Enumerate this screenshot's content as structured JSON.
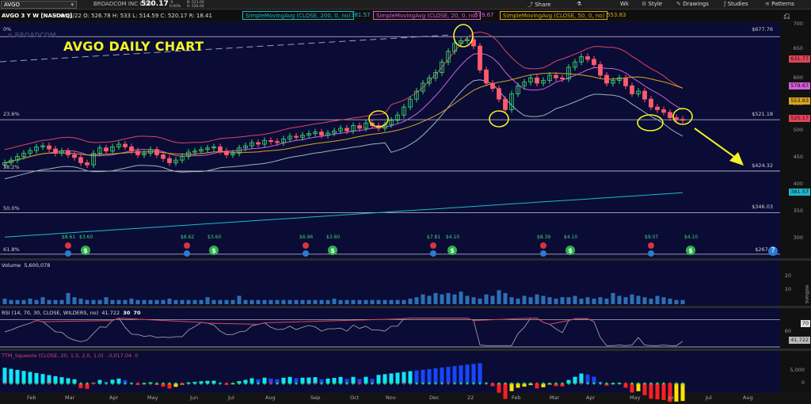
{
  "toolbar": {
    "symbol": "AVGO",
    "company": "BROADCOM INC COM",
    "last": "520.17",
    "change_line1": "-0",
    "change_line2": "0.00%",
    "bid_line": "B: 521.00",
    "ask_line": "A: 526.00",
    "share_label": "Share",
    "wk_label": "Wk",
    "style_label": "Style",
    "drawings_label": "Drawings",
    "studies_label": "Studies",
    "patterns_label": "Patterns"
  },
  "header": {
    "title_symbol": "AVGO 3 Y W [NASDAQ]",
    "quote": "D: 6/13/22   O: 526.78   H: 533   L: 514.59   C: 520.17   R: 18.41",
    "sma200_label": "SimpleMovingAvg (CLOSE, 200, 0, no)",
    "sma200_value": "381.57",
    "sma20_label": "SimpleMovingAvg (CLOSE, 20, 0, no)",
    "sma20_value": "579.67",
    "sma50_label": "SimpleMovingAvg (CLOSE, 50, 0, no)",
    "sma50_value": "553.83"
  },
  "annotation": {
    "title": "AVGO DAILY CHART",
    "watermark": "⊕ BROADCOM"
  },
  "fib": [
    {
      "label": "0%",
      "level": 677.76
    },
    {
      "label": "23.6%",
      "level": 521.18
    },
    {
      "label": "38.2%",
      "level": 424.32
    },
    {
      "label": "50.0%",
      "level": 346.03
    },
    {
      "label": "61.8%",
      "level": 267.7
    }
  ],
  "levels": [
    "$677.76",
    "$521.18",
    "$424.32",
    "$346.03",
    "$267.7"
  ],
  "price_axis": {
    "ticks": [
      "700",
      "650",
      "600",
      "550",
      "500",
      "450",
      "400",
      "350",
      "300"
    ],
    "badges": [
      {
        "text": "631.77",
        "color": "#e0445a"
      },
      {
        "text": "579.67",
        "color": "#d35fd8"
      },
      {
        "text": "553.83",
        "color": "#d8a520"
      },
      {
        "text": "520.17",
        "color": "#e0445a"
      },
      {
        "text": "381.57",
        "color": "#21b6c9"
      }
    ]
  },
  "volume": {
    "title": "Volume",
    "value": "5,600,078",
    "ticks": [
      "20",
      "10"
    ],
    "unit": "millions"
  },
  "rsi": {
    "title": "RSI (14, 70, 30, CLOSE, WILDERS, no)",
    "value": "41.722",
    "ob": "30",
    "os": "70",
    "ticks": [
      "70",
      "60"
    ],
    "badge": "41.722"
  },
  "squeeze": {
    "title": "TTM_Squeeze (CLOSE, 20, 1.5, 2.0, 1.0)",
    "value": "-3,017.04",
    "extra": "0",
    "ticks": [
      "5,000",
      "0"
    ]
  },
  "x_labels": [
    "Feb",
    "Mar",
    "Apr",
    "May",
    "Jun",
    "Jul",
    "Aug",
    "Sep",
    "Oct",
    "Nov",
    "Dec",
    "22",
    "Feb",
    "Mar",
    "Apr",
    "May",
    "Jun",
    "Jul",
    "Aug"
  ],
  "earnings_markers": [
    {
      "label": "$8.61"
    },
    {
      "label": "$3.60"
    },
    {
      "label": "$8.62"
    },
    {
      "label": "$3.60"
    },
    {
      "label": "$6.96"
    },
    {
      "label": "$3.60"
    },
    {
      "label": "$7.81"
    },
    {
      "label": "$4.10"
    },
    {
      "label": "$8.39"
    },
    {
      "label": "$4.10"
    },
    {
      "label": "$9.07"
    },
    {
      "label": "$4.10"
    }
  ],
  "chart_data": {
    "type": "candlestick",
    "title": "AVGO DAILY CHART",
    "ylim": [
      260,
      705
    ],
    "series": [
      {
        "name": "SMA 200",
        "color": "#21b6c9"
      },
      {
        "name": "SMA 20",
        "color": "#d35fd8"
      },
      {
        "name": "SMA 50",
        "color": "#d8a520"
      }
    ],
    "closes": [
      440,
      445,
      452,
      458,
      463,
      470,
      472,
      466,
      458,
      462,
      455,
      450,
      440,
      436,
      458,
      468,
      462,
      470,
      475,
      470,
      462,
      455,
      458,
      465,
      455,
      448,
      440,
      445,
      452,
      460,
      462,
      465,
      468,
      470,
      462,
      455,
      458,
      468,
      472,
      478,
      475,
      482,
      480,
      478,
      485,
      490,
      488,
      492,
      495,
      498,
      492,
      496,
      500,
      505,
      500,
      510,
      505,
      515,
      510,
      505,
      512,
      520,
      530,
      545,
      560,
      575,
      590,
      600,
      610,
      630,
      650,
      665,
      670,
      672,
      660,
      615,
      590,
      580,
      560,
      540,
      570,
      585,
      592,
      600,
      590,
      595,
      605,
      600,
      598,
      620,
      630,
      640,
      635,
      625,
      605,
      590,
      595,
      600,
      585,
      570,
      575,
      560,
      545,
      540,
      535,
      525,
      522,
      520
    ],
    "volume_millions": [
      4,
      3,
      3,
      3,
      4,
      3,
      5,
      3,
      3,
      3,
      8,
      5,
      4,
      3,
      3,
      3,
      5,
      3,
      3,
      3,
      4,
      3,
      3,
      3,
      3,
      3,
      4,
      3,
      3,
      3,
      3,
      3,
      5,
      3,
      3,
      3,
      3,
      6,
      3,
      3,
      3,
      3,
      3,
      3,
      3,
      3,
      3,
      3,
      3,
      3,
      3,
      3,
      4,
      3,
      3,
      3,
      3,
      3,
      3,
      3,
      3,
      3,
      3,
      3,
      4,
      5,
      7,
      6,
      8,
      7,
      8,
      7,
      9,
      6,
      5,
      4,
      7,
      6,
      10,
      8,
      5,
      4,
      6,
      5,
      7,
      6,
      5,
      4,
      5,
      5,
      6,
      4,
      5,
      4,
      5,
      4,
      8,
      6,
      5,
      7,
      6,
      5,
      4,
      6,
      5,
      4,
      3,
      3
    ],
    "rsi_range": [
      30,
      75
    ],
    "squeeze_range": [
      -3000,
      8500
    ]
  }
}
